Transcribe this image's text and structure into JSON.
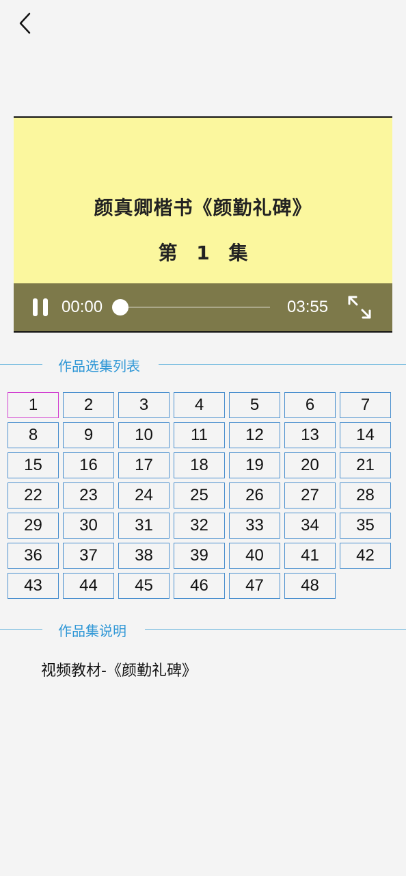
{
  "video": {
    "title": "颜真卿楷书《颜勤礼碑》",
    "episode_label": "第 1 集",
    "current_time": "00:00",
    "total_time": "03:55",
    "progress": 0
  },
  "episode_list": {
    "header": "作品选集列表",
    "selected": "1",
    "items": [
      "1",
      "2",
      "3",
      "4",
      "5",
      "6",
      "7",
      "8",
      "9",
      "10",
      "11",
      "12",
      "13",
      "14",
      "15",
      "16",
      "17",
      "18",
      "19",
      "20",
      "21",
      "22",
      "23",
      "24",
      "25",
      "26",
      "27",
      "28",
      "29",
      "30",
      "31",
      "32",
      "33",
      "34",
      "35",
      "36",
      "37",
      "38",
      "39",
      "40",
      "41",
      "42",
      "43",
      "44",
      "45",
      "46",
      "47",
      "48"
    ]
  },
  "description": {
    "header": "作品集说明",
    "text": "视频教材-《颜勤礼碑》"
  },
  "colors": {
    "accent": "#2f97d6",
    "video_bg": "#fbf79e",
    "controls_bg": "#7d794a",
    "selected_border": "#d13fd0",
    "item_border": "#4a8fce"
  }
}
